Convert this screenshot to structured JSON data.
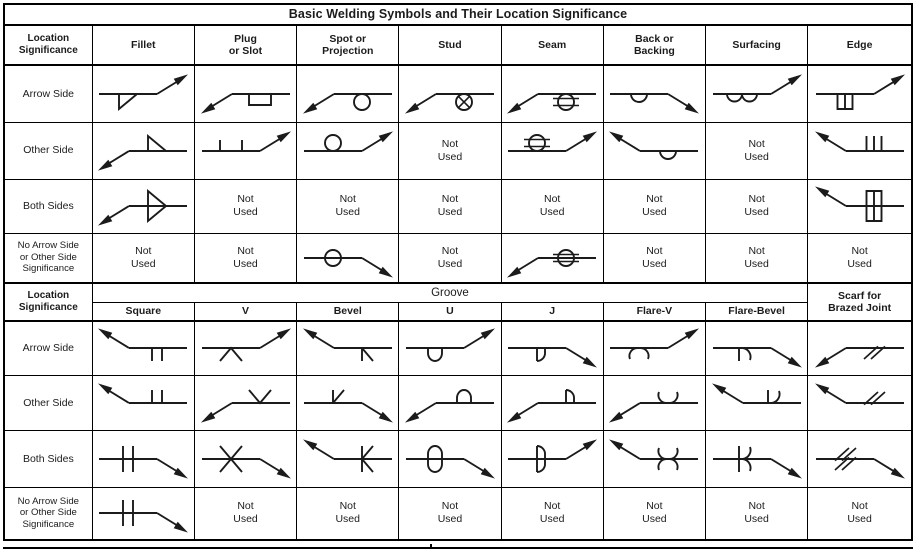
{
  "table": {
    "title": "Basic Welding Symbols and Their Location Significance",
    "row_header_label": "Location Significance",
    "not_used": "Not\nUsed",
    "not_used_line1": "Not",
    "not_used_line2": "Used",
    "colors": {
      "line": "#1b1b1b",
      "border": "#000000",
      "background": "#ffffff",
      "text": "#1b1b1b"
    },
    "section1": {
      "columns": [
        {
          "label": "Fillet",
          "key": "fillet"
        },
        {
          "label": "Plug\nor Slot",
          "key": "plug"
        },
        {
          "label": "Spot or\nProjection",
          "key": "spot"
        },
        {
          "label": "Stud",
          "key": "stud"
        },
        {
          "label": "Seam",
          "key": "seam"
        },
        {
          "label": "Back or\nBacking",
          "key": "back"
        },
        {
          "label": "Surfacing",
          "key": "surfacing"
        },
        {
          "label": "Edge",
          "key": "edge"
        }
      ],
      "rows": [
        {
          "label": "Arrow Side",
          "cells": [
            {
              "sym": "fillet",
              "side": "below",
              "arrow": "up-right",
              "used": true
            },
            {
              "sym": "plug",
              "side": "below",
              "arrow": "down-left",
              "used": true
            },
            {
              "sym": "spot",
              "side": "below",
              "arrow": "down-left",
              "used": true
            },
            {
              "sym": "stud",
              "side": "below",
              "arrow": "down-left",
              "used": true
            },
            {
              "sym": "seam",
              "side": "below",
              "arrow": "down-left",
              "used": true
            },
            {
              "sym": "back",
              "side": "below",
              "arrow": "down-right",
              "used": true
            },
            {
              "sym": "surfacing",
              "side": "below",
              "arrow": "up-right",
              "used": true
            },
            {
              "sym": "edge",
              "side": "below",
              "arrow": "up-right",
              "used": true
            }
          ]
        },
        {
          "label": "Other Side",
          "cells": [
            {
              "sym": "fillet",
              "side": "above",
              "arrow": "down-left",
              "used": true
            },
            {
              "sym": "plug",
              "side": "above",
              "arrow": "up-right",
              "used": true
            },
            {
              "sym": "spot",
              "side": "above",
              "arrow": "up-right",
              "used": true
            },
            {
              "sym": "none",
              "used": false
            },
            {
              "sym": "seam",
              "side": "above",
              "arrow": "up-right",
              "used": true
            },
            {
              "sym": "back",
              "side": "below",
              "arrow": "up-left",
              "used": true
            },
            {
              "sym": "none",
              "used": false
            },
            {
              "sym": "edge",
              "side": "above",
              "arrow": "up-left",
              "used": true
            }
          ]
        },
        {
          "label": "Both Sides",
          "cells": [
            {
              "sym": "fillet",
              "side": "both",
              "arrow": "down-left",
              "used": true
            },
            {
              "sym": "none",
              "used": false
            },
            {
              "sym": "none",
              "used": false
            },
            {
              "sym": "none",
              "used": false
            },
            {
              "sym": "none",
              "used": false
            },
            {
              "sym": "none",
              "used": false
            },
            {
              "sym": "none",
              "used": false
            },
            {
              "sym": "edge",
              "side": "both",
              "arrow": "up-left",
              "used": true
            }
          ]
        },
        {
          "label": "No Arrow Side\nor Other Side\nSignificance",
          "cells": [
            {
              "sym": "none",
              "used": false
            },
            {
              "sym": "none",
              "used": false
            },
            {
              "sym": "spot",
              "side": "center",
              "arrow": "down-right",
              "used": true
            },
            {
              "sym": "none",
              "used": false
            },
            {
              "sym": "seam",
              "side": "center",
              "arrow": "down-left",
              "used": true
            },
            {
              "sym": "none",
              "used": false
            },
            {
              "sym": "none",
              "used": false
            },
            {
              "sym": "none",
              "used": false
            }
          ]
        }
      ]
    },
    "section2": {
      "group_label": "Groove",
      "scarf_label": "Scarf for\nBrazed Joint",
      "columns": [
        {
          "label": "Square",
          "key": "square"
        },
        {
          "label": "V",
          "key": "vee"
        },
        {
          "label": "Bevel",
          "key": "bevel"
        },
        {
          "label": "U",
          "key": "ugroove"
        },
        {
          "label": "J",
          "key": "jgroove"
        },
        {
          "label": "Flare-V",
          "key": "flarev"
        },
        {
          "label": "Flare-Bevel",
          "key": "flarebevel"
        },
        {
          "label": "Scarf",
          "key": "scarf"
        }
      ],
      "rows": [
        {
          "label": "Arrow Side",
          "cells": [
            {
              "sym": "square",
              "side": "below",
              "arrow": "up-left",
              "used": true
            },
            {
              "sym": "vee",
              "side": "below",
              "arrow": "up-right",
              "used": true
            },
            {
              "sym": "bevel",
              "side": "below",
              "arrow": "up-left",
              "used": true
            },
            {
              "sym": "ugroove",
              "side": "below",
              "arrow": "up-right",
              "used": true
            },
            {
              "sym": "jgroove",
              "side": "below",
              "arrow": "down-right",
              "used": true
            },
            {
              "sym": "flarev",
              "side": "below",
              "arrow": "up-right",
              "used": true
            },
            {
              "sym": "flarebevel",
              "side": "below",
              "arrow": "down-right",
              "used": true
            },
            {
              "sym": "scarf",
              "side": "below",
              "arrow": "down-left",
              "used": true
            }
          ]
        },
        {
          "label": "Other Side",
          "cells": [
            {
              "sym": "square",
              "side": "above",
              "arrow": "up-left",
              "used": true
            },
            {
              "sym": "vee",
              "side": "above",
              "arrow": "down-left",
              "used": true
            },
            {
              "sym": "bevel",
              "side": "above",
              "arrow": "down-right",
              "used": true
            },
            {
              "sym": "ugroove",
              "side": "above",
              "arrow": "down-left",
              "used": true
            },
            {
              "sym": "jgroove",
              "side": "above",
              "arrow": "down-left",
              "used": true
            },
            {
              "sym": "flarev",
              "side": "above",
              "arrow": "down-left",
              "used": true
            },
            {
              "sym": "flarebevel",
              "side": "above",
              "arrow": "up-left",
              "used": true
            },
            {
              "sym": "scarf",
              "side": "above",
              "arrow": "up-left",
              "used": true
            }
          ]
        },
        {
          "label": "Both Sides",
          "cells": [
            {
              "sym": "square",
              "side": "both",
              "arrow": "down-right",
              "used": true
            },
            {
              "sym": "vee",
              "side": "both",
              "arrow": "down-right",
              "used": true
            },
            {
              "sym": "bevel",
              "side": "both",
              "arrow": "up-left",
              "used": true
            },
            {
              "sym": "ugroove",
              "side": "both",
              "arrow": "down-right",
              "used": true
            },
            {
              "sym": "jgroove",
              "side": "both",
              "arrow": "up-right",
              "used": true
            },
            {
              "sym": "flarev",
              "side": "both",
              "arrow": "up-left",
              "used": true
            },
            {
              "sym": "flarebevel",
              "side": "both",
              "arrow": "down-right",
              "used": true
            },
            {
              "sym": "scarf",
              "side": "both",
              "arrow": "down-right",
              "used": true
            }
          ]
        },
        {
          "label": "No Arrow Side\nor Other Side\nSignificance",
          "cells": [
            {
              "sym": "square",
              "side": "both",
              "arrow": "down-right",
              "used": true
            },
            {
              "sym": "none",
              "used": false
            },
            {
              "sym": "none",
              "used": false
            },
            {
              "sym": "none",
              "used": false
            },
            {
              "sym": "none",
              "used": false
            },
            {
              "sym": "none",
              "used": false
            },
            {
              "sym": "none",
              "used": false
            },
            {
              "sym": "none",
              "used": false
            }
          ]
        }
      ]
    }
  }
}
